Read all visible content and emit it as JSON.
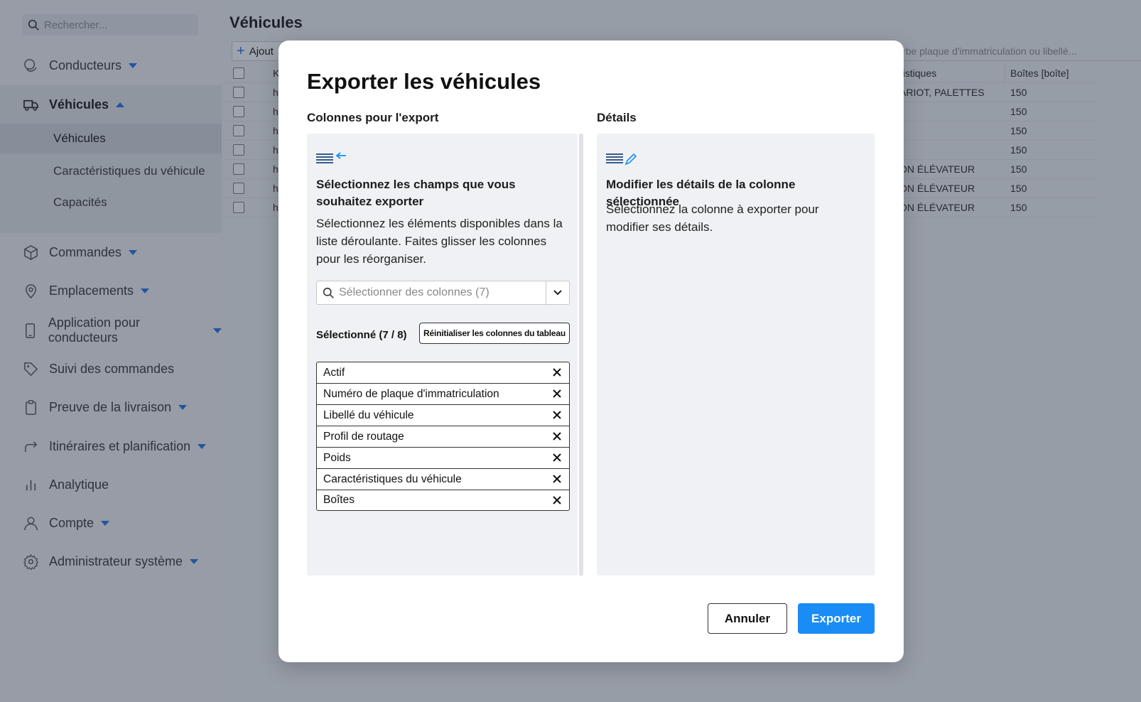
{
  "sidebar": {
    "search_placeholder": "Rechercher...",
    "items": [
      {
        "label": "Conducteurs",
        "icon": "drivers-icon"
      },
      {
        "label": "Véhicules",
        "icon": "truck-icon"
      },
      {
        "label": "Commandes",
        "icon": "package-icon"
      },
      {
        "label": "Emplacements",
        "icon": "location-pin-icon"
      },
      {
        "label": "Application pour conducteurs",
        "icon": "phone-icon"
      },
      {
        "label": "Suivi des commandes",
        "icon": "tag-icon"
      },
      {
        "label": "Preuve de la livraison",
        "icon": "clipboard-icon"
      },
      {
        "label": "Itinéraires et planification",
        "icon": "route-arrow-icon"
      },
      {
        "label": "Analytique",
        "icon": "bar-chart-icon"
      },
      {
        "label": "Compte",
        "icon": "user-icon"
      },
      {
        "label": "Administrateur système",
        "icon": "gear-icon"
      }
    ],
    "submenu": [
      "Véhicules",
      "Caractéristiques du véhicule",
      "Capacités"
    ]
  },
  "background": {
    "title": "Véhicules",
    "add_label": "Ajout",
    "filter_placeholder": "rbe plaque d'immatriculation ou libellé...",
    "header": {
      "k": "K",
      "car": "ristiques",
      "box": "Boîtes [boîte]"
    },
    "rows": [
      {
        "k": "h",
        "car": "ARIOT, PALETTES",
        "box": "150"
      },
      {
        "k": "h",
        "car": "",
        "box": "150"
      },
      {
        "k": "h",
        "car": "",
        "box": "150"
      },
      {
        "k": "h",
        "car": "",
        "box": "150"
      },
      {
        "k": "h",
        "car": "ON ÉLÉVATEUR",
        "box": "150"
      },
      {
        "k": "h",
        "car": "ON ÉLÉVATEUR",
        "box": "150"
      },
      {
        "k": "h",
        "car": "ON ÉLÉVATEUR",
        "box": "150"
      }
    ]
  },
  "modal": {
    "title": "Exporter les véhicules",
    "left_title": "Colonnes pour l'export",
    "right_title": "Détails",
    "left_heading": "Sélectionnez les champs que vous souhaitez exporter",
    "left_text": "Sélectionnez les éléments disponibles dans la liste déroulante. Faites glisser les colonnes pour les réorganiser.",
    "select_placeholder": "Sélectionner des colonnes (7)",
    "selected_label": "Sélectionné (7 / 8)",
    "reset_label": "Réinitialiser les colonnes du tableau",
    "columns": [
      "Actif",
      "Numéro de plaque d'immatriculation",
      "Libellé du véhicule",
      "Profil de routage",
      "Poids",
      "Caractéristiques du véhicule",
      "Boîtes"
    ],
    "right_heading": "Modifier les détails de la colonne sélectionnée",
    "right_text": "Sélectionnez la colonne à exporter pour modifier ses détails.",
    "cancel_label": "Annuler",
    "export_label": "Exporter"
  },
  "colors": {
    "accent": "#1a8cf5",
    "caret": "#1a73e8"
  }
}
